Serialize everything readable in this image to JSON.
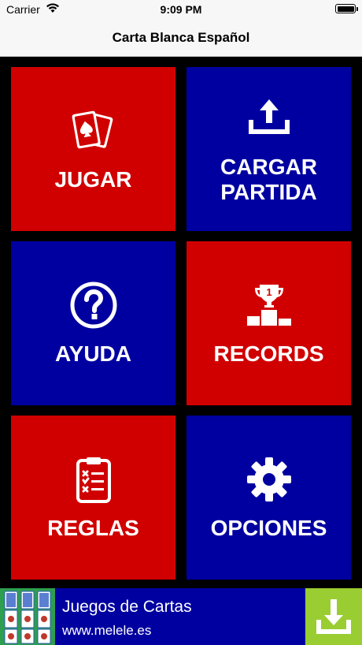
{
  "status_bar": {
    "carrier": "Carrier",
    "time": "9:09 PM",
    "battery_level": 1.0
  },
  "nav": {
    "title": "Carta Blanca Español"
  },
  "tiles": [
    {
      "label": "JUGAR",
      "color": "#d00000",
      "icon": "playing-cards-icon"
    },
    {
      "label": "CARGAR\nPARTIDA",
      "color": "#0000a0",
      "icon": "upload-icon"
    },
    {
      "label": "AYUDA",
      "color": "#0000a0",
      "icon": "question-circle-icon"
    },
    {
      "label": "RECORDS",
      "color": "#d00000",
      "icon": "trophy-podium-icon"
    },
    {
      "label": "REGLAS",
      "color": "#d00000",
      "icon": "clipboard-checklist-icon"
    },
    {
      "label": "OPCIONES",
      "color": "#0000a0",
      "icon": "gear-icon"
    }
  ],
  "ad": {
    "title": "Juegos de Cartas",
    "url": "www.melele.es",
    "background": "#0000a0",
    "download_color": "#9acd32",
    "icon": "download-icon"
  }
}
